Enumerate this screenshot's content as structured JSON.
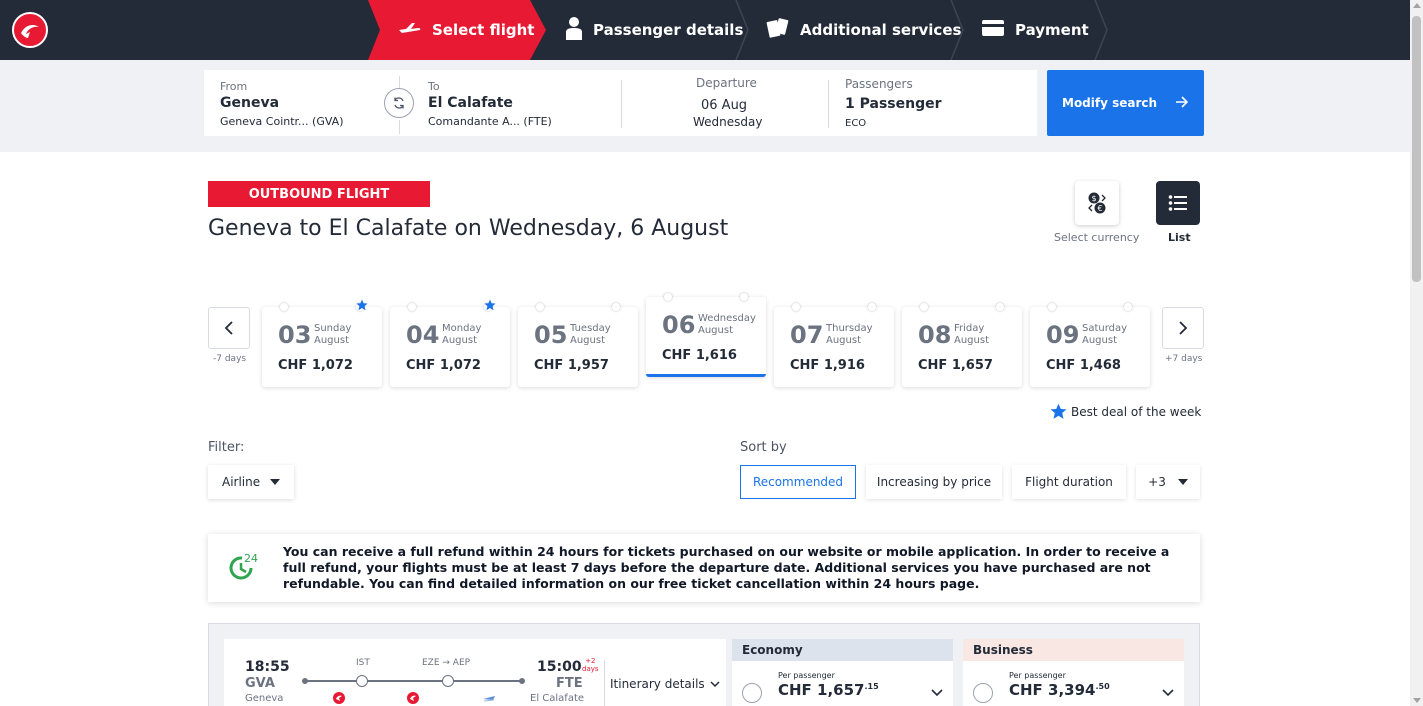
{
  "header": {
    "steps": [
      {
        "label": "Select flight",
        "icon": "plane-icon",
        "active": true
      },
      {
        "label": "Passenger details",
        "icon": "person-icon"
      },
      {
        "label": "Additional services",
        "icon": "cards-icon"
      },
      {
        "label": "Payment",
        "icon": "credit-card-icon"
      }
    ]
  },
  "search": {
    "from_label": "From",
    "from_city": "Geneva",
    "from_airport": "Geneva Cointr...  (GVA)",
    "to_label": "To",
    "to_city": "El Calafate",
    "to_airport": "Comandante A...  (FTE)",
    "departure_label": "Departure",
    "departure_date": "06 Aug",
    "departure_day": "Wednesday",
    "passengers_label": "Passengers",
    "passengers_value": "1 Passenger",
    "cabin_class": "ECO",
    "modify_label": "Modify search"
  },
  "outbound": {
    "badge": "OUTBOUND FLIGHT",
    "title": "Geneva to El Calafate on Wednesday, 6 August",
    "currency_label": "Select currency",
    "list_label": "List"
  },
  "dates": {
    "prev_label": "-7 days",
    "next_label": "+7 days",
    "items": [
      {
        "day": "03",
        "weekday": "Sunday",
        "month": "August",
        "price": "CHF 1,072",
        "best": true
      },
      {
        "day": "04",
        "weekday": "Monday",
        "month": "August",
        "price": "CHF 1,072",
        "best": true
      },
      {
        "day": "05",
        "weekday": "Tuesday",
        "month": "August",
        "price": "CHF 1,957"
      },
      {
        "day": "06",
        "weekday": "Wednesday",
        "month": "August",
        "price": "CHF 1,616",
        "selected": true
      },
      {
        "day": "07",
        "weekday": "Thursday",
        "month": "August",
        "price": "CHF 1,916"
      },
      {
        "day": "08",
        "weekday": "Friday",
        "month": "August",
        "price": "CHF 1,657"
      },
      {
        "day": "09",
        "weekday": "Saturday",
        "month": "August",
        "price": "CHF 1,468"
      }
    ],
    "best_deal_label": "Best deal of the week"
  },
  "filter": {
    "label": "Filter:",
    "airline_label": "Airline"
  },
  "sort": {
    "label": "Sort by",
    "options": [
      "Recommended",
      "Increasing by price",
      "Flight duration"
    ],
    "more": "+3"
  },
  "notice": {
    "badge_number": "24",
    "text": "You can receive a full refund within 24 hours for tickets purchased on our website or mobile application. In order to receive a full refund, your flights must be at least 7 days before the departure date. Additional services you have purchased are not refundable. You can find detailed information on our free ticket cancellation within 24 hours page."
  },
  "flight": {
    "dep_time": "18:55",
    "dep_code": "GVA",
    "dep_city": "Geneva",
    "arr_time": "15:00",
    "arr_plus_top": "+2",
    "arr_plus_bottom": "days",
    "arr_code": "FTE",
    "arr_city": "El Calafate",
    "stop1": "IST",
    "stop2": "EZE → AEP",
    "itinerary_label": "Itinerary details",
    "economy": {
      "label": "Economy",
      "per": "Per passenger",
      "price": "CHF 1,657",
      "cents": ".15"
    },
    "business": {
      "label": "Business",
      "per": "Per passenger",
      "price": "CHF 3,394",
      "cents": ".50"
    }
  },
  "colors": {
    "brand_red": "#e81932",
    "header_dark": "#232b38",
    "accent_blue": "#1a73e8",
    "economy_header": "#dde3ec",
    "business_header": "#f9e7e4"
  }
}
